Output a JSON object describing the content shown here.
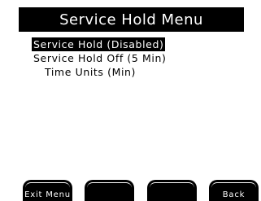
{
  "title": "Service Hold Menu",
  "menu": {
    "items": [
      {
        "label": "Service Hold (Disabled)",
        "selected": true
      },
      {
        "label": "Service Hold Off (5 Min)",
        "selected": false
      },
      {
        "label": "Time Units (Min)",
        "selected": false
      }
    ]
  },
  "softkeys": [
    {
      "label": "Exit Menu"
    },
    {
      "label": ""
    },
    {
      "label": ""
    },
    {
      "label": "Back"
    }
  ],
  "colors": {
    "background": "#ffffff",
    "foreground": "#000000",
    "inverse_text": "#ffffff"
  }
}
